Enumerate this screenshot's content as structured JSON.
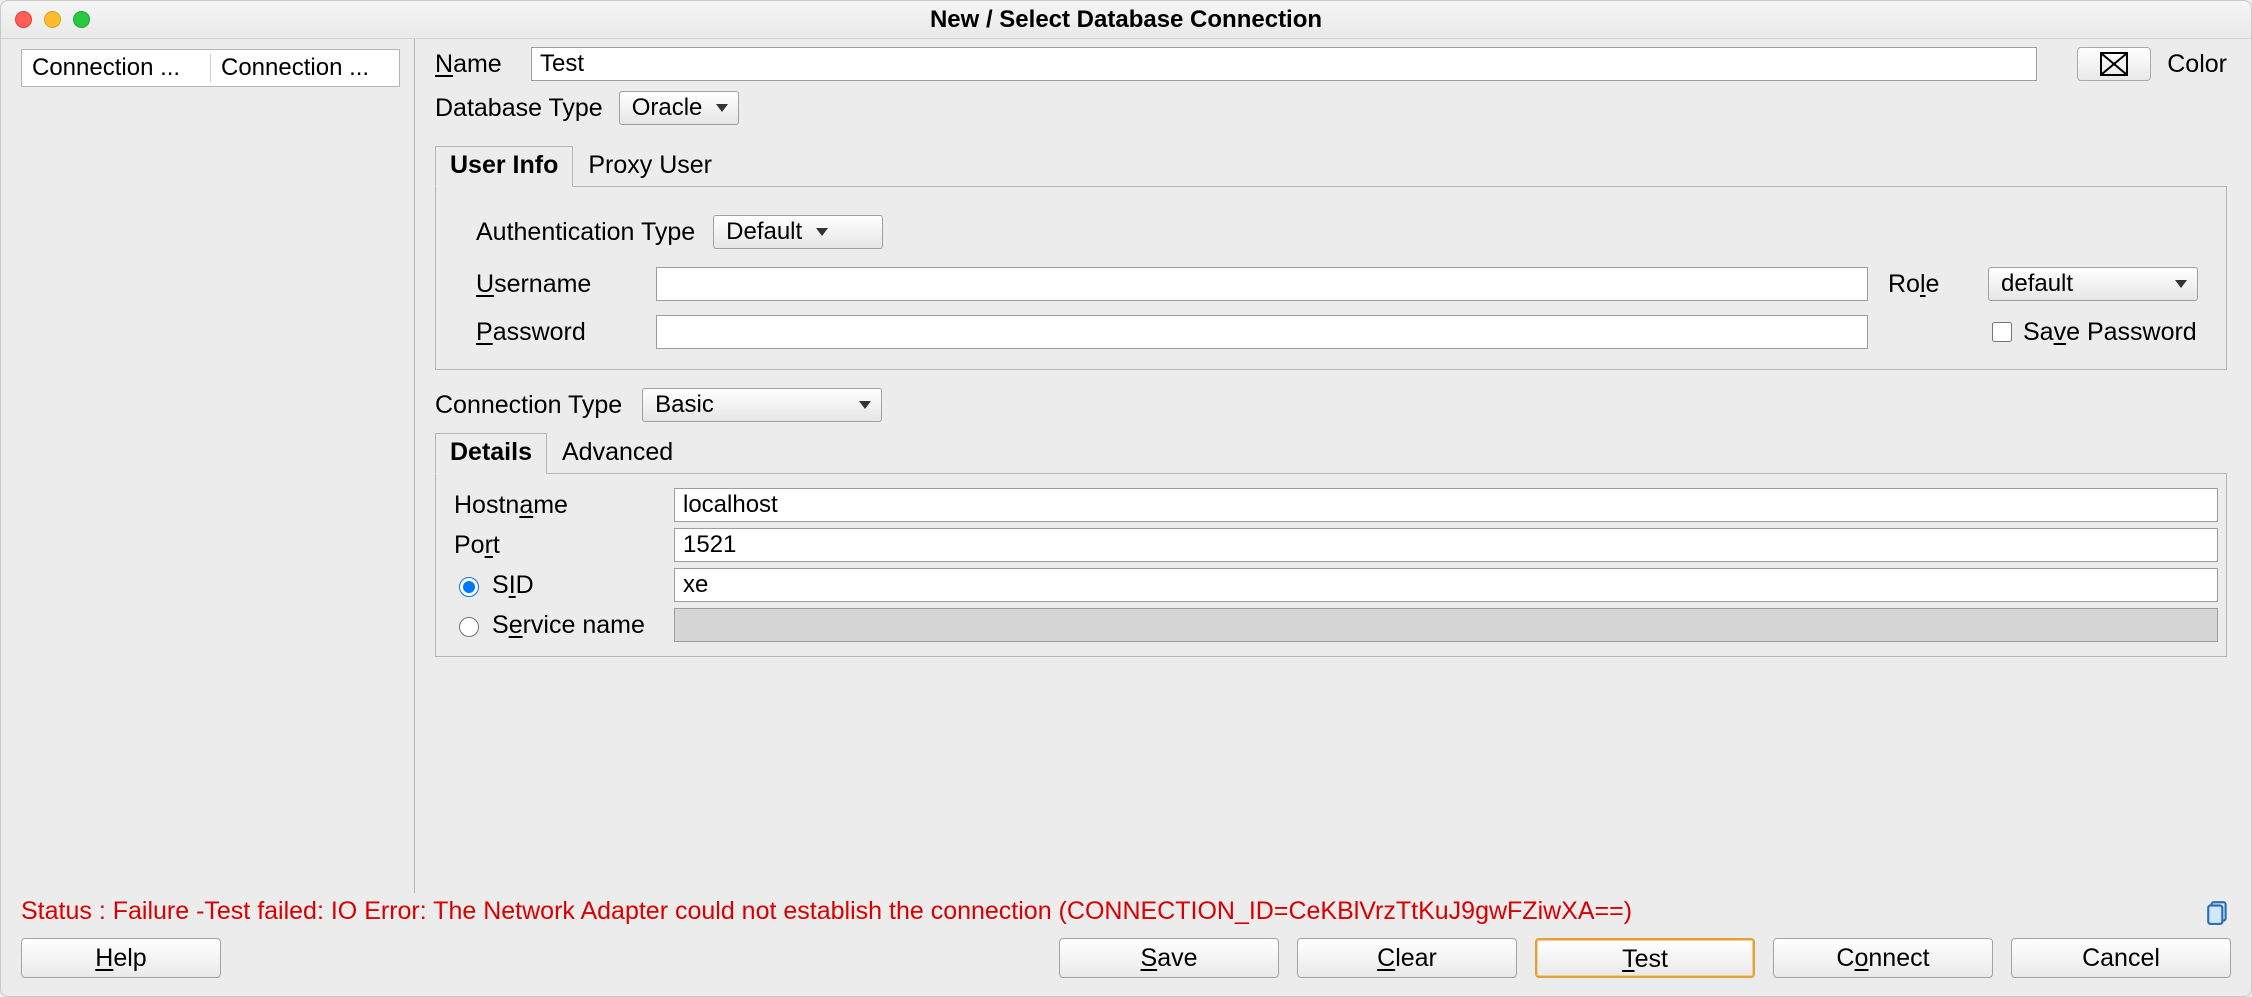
{
  "window": {
    "title": "New / Select Database Connection"
  },
  "sidebar": {
    "columns": [
      "Connection ...",
      "Connection ..."
    ]
  },
  "form": {
    "name_label": "Name",
    "name_value": "Test",
    "color_label": "Color",
    "dbtype_label": "Database Type",
    "dbtype_value": "Oracle"
  },
  "auth_tabs": [
    {
      "label": "User Info",
      "active": true
    },
    {
      "label": "Proxy User",
      "active": false
    }
  ],
  "auth": {
    "auth_type_label": "Authentication Type",
    "auth_type_value": "Default",
    "username_label": "Username",
    "username_value": "",
    "password_label": "Password",
    "password_value": "",
    "role_label": "Role",
    "role_value": "default",
    "save_password_label": "Save Password",
    "save_password_checked": false
  },
  "conn": {
    "conn_type_label": "Connection Type",
    "conn_type_value": "Basic"
  },
  "detail_tabs": [
    {
      "label": "Details",
      "active": true
    },
    {
      "label": "Advanced",
      "active": false
    }
  ],
  "details": {
    "hostname_label": "Hostname",
    "hostname_value": "localhost",
    "port_label": "Port",
    "port_value": "1521",
    "sid_label": "SID",
    "sid_value": "xe",
    "service_label": "Service name",
    "service_value": "",
    "selected": "sid"
  },
  "mnemonics": {
    "name_u": "N",
    "username_u": "U",
    "password_u": "P",
    "role_u": "l",
    "save_u": "v",
    "hostname_u": "a",
    "port_u": "r",
    "sid_u": "I",
    "service_u": "e",
    "help_u": "H",
    "save_btn_u": "S",
    "clear_u": "C",
    "test_u": "T",
    "connect_u": "o"
  },
  "status": {
    "text": "Status : Failure -Test failed: IO Error: The Network Adapter could not establish the connection (CONNECTION_ID=CeKBlVrzTtKuJ9gwFZiwXA==)"
  },
  "buttons": {
    "help": "Help",
    "save": "Save",
    "clear": "Clear",
    "test": "Test",
    "connect": "Connect",
    "cancel": "Cancel"
  }
}
